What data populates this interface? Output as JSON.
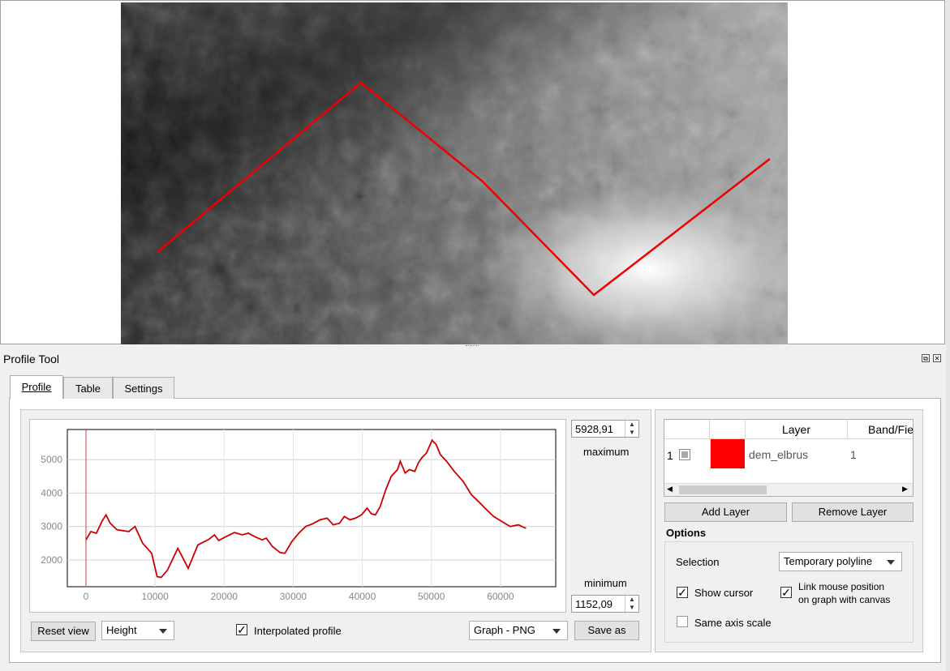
{
  "dock": {
    "title": "Profile Tool",
    "float_glyph": "⧉",
    "close_glyph": "✕"
  },
  "tabs": [
    {
      "label": "Profile"
    },
    {
      "label": "Table"
    },
    {
      "label": "Settings"
    }
  ],
  "plot": {
    "max_value": "5928,91",
    "max_label": "maximum",
    "min_value": "1152,09",
    "min_label": "minimum",
    "y_ticks": [
      "5000",
      "4000",
      "3000",
      "2000"
    ],
    "x_ticks": [
      "0",
      "10000",
      "20000",
      "30000",
      "40000",
      "50000",
      "60000"
    ]
  },
  "chart_data": {
    "type": "line",
    "xlim": [
      -2700,
      68000
    ],
    "ylim": [
      1200,
      5900
    ],
    "y_tick_values": [
      5000,
      4000,
      3000,
      2000
    ],
    "x_tick_values": [
      0,
      10000,
      20000,
      30000,
      40000,
      50000,
      60000
    ],
    "grid": true,
    "cursor_x": 0,
    "line_color": "#cc0000",
    "series": [
      {
        "x": [
          0,
          700,
          1500,
          2300,
          2900,
          3500,
          4500,
          6200,
          7100,
          8200,
          9500,
          10300,
          10900,
          11800,
          13300,
          14800,
          16200,
          17800,
          18600,
          19200,
          20300,
          21500,
          22600,
          23500,
          24600,
          25500,
          26100,
          27000,
          28100,
          28800,
          29800,
          30800,
          31800,
          32800,
          33900,
          34900,
          35800,
          36700,
          37400,
          38200,
          39000,
          39900,
          40700,
          41300,
          41900,
          42600,
          43400,
          44200,
          45100,
          45500,
          46200,
          46800,
          47600,
          48100,
          48600,
          49300,
          50100,
          50700,
          51300,
          52200,
          53300,
          54600,
          55800,
          56800,
          58000,
          59000,
          60200,
          61400,
          62600,
          63100,
          63700
        ],
        "y": [
          2600,
          2850,
          2800,
          3150,
          3350,
          3100,
          2900,
          2850,
          3000,
          2500,
          2200,
          1500,
          1480,
          1700,
          2350,
          1750,
          2450,
          2620,
          2750,
          2580,
          2700,
          2820,
          2750,
          2800,
          2680,
          2600,
          2650,
          2400,
          2220,
          2200,
          2550,
          2800,
          3000,
          3080,
          3200,
          3250,
          3050,
          3100,
          3300,
          3200,
          3250,
          3350,
          3550,
          3380,
          3350,
          3600,
          4100,
          4500,
          4700,
          4950,
          4600,
          4700,
          4650,
          4900,
          5050,
          5200,
          5580,
          5450,
          5150,
          4950,
          4650,
          4350,
          3950,
          3750,
          3500,
          3300,
          3150,
          3000,
          3050,
          3000,
          2950
        ]
      }
    ]
  },
  "controls": {
    "reset_view": "Reset view",
    "mode_combo": "Height",
    "interpolated_label": "Interpolated profile",
    "interpolated_checked": "✓",
    "format_combo": "Graph - PNG",
    "save_as": "Save as"
  },
  "layer_table": {
    "headers": [
      "",
      "",
      "Layer",
      "Band/Fie"
    ],
    "rows": [
      {
        "num": "1",
        "color": "#ff0000",
        "layer": "dem_elbrus",
        "band": "1"
      }
    ],
    "scroll_left": "◀",
    "scroll_right": "▶"
  },
  "layer_buttons": {
    "add": "Add Layer",
    "remove": "Remove Layer"
  },
  "options": {
    "title": "Options",
    "selection_label": "Selection",
    "selection_value": "Temporary polyline",
    "show_cursor": "Show cursor",
    "show_cursor_checked": "✓",
    "link_mouse_line1": "Link mouse position",
    "link_mouse_line2": "on graph with canvas",
    "link_mouse_checked": "✓",
    "same_axis": "Same axis scale"
  }
}
